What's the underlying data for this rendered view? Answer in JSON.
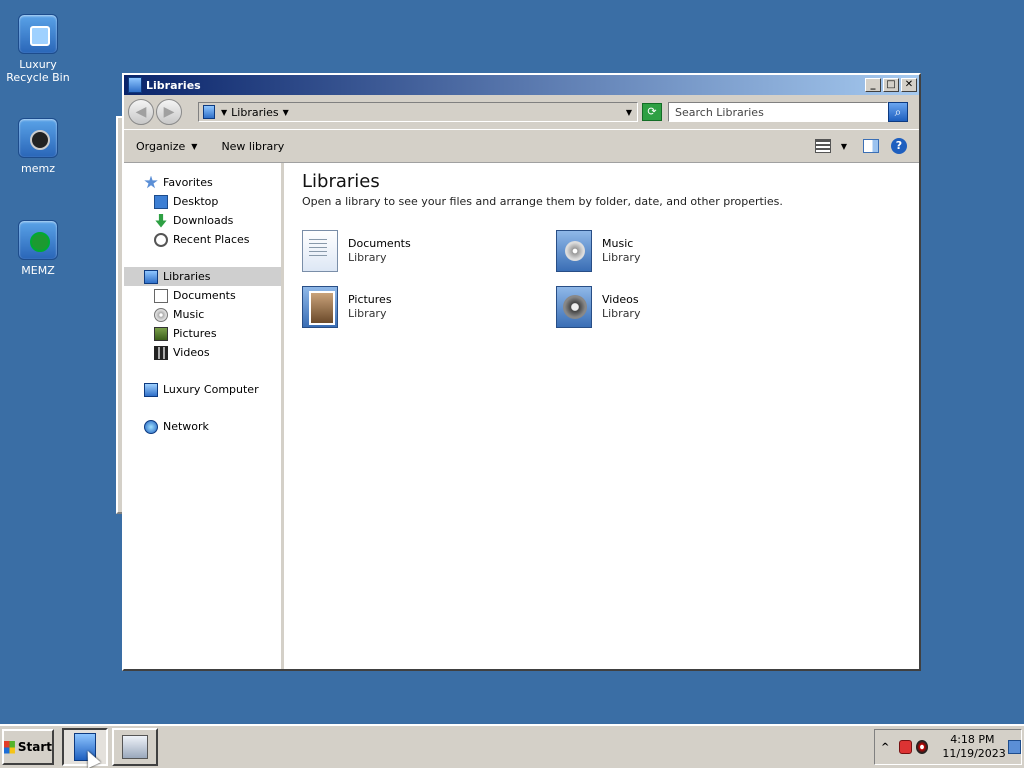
{
  "desktop": {
    "icons": [
      {
        "label": "Luxury Recycle Bin"
      },
      {
        "label": "memz"
      },
      {
        "label": "MEMZ"
      }
    ]
  },
  "window": {
    "title": "Libraries",
    "controls": {
      "minimize": "_",
      "maximize": "□",
      "close": "✕"
    }
  },
  "addressbar": {
    "crumb": "Libraries",
    "search_placeholder": "Search Libraries"
  },
  "toolbar": {
    "organize": "Organize",
    "new_library": "New library"
  },
  "navpane": {
    "favorites": {
      "label": "Favorites",
      "items": [
        "Desktop",
        "Downloads",
        "Recent Places"
      ]
    },
    "libraries": {
      "label": "Libraries",
      "items": [
        "Documents",
        "Music",
        "Pictures",
        "Videos"
      ]
    },
    "computer": "Luxury Computer",
    "network": "Network"
  },
  "content": {
    "title": "Libraries",
    "description": "Open a library to see your files and arrange them by folder, date, and other properties.",
    "libraries": [
      {
        "name": "Documents",
        "type": "Library"
      },
      {
        "name": "Music",
        "type": "Library"
      },
      {
        "name": "Pictures",
        "type": "Library"
      },
      {
        "name": "Videos",
        "type": "Library"
      }
    ]
  },
  "taskbar": {
    "start_label": "Start",
    "tray": {
      "chevron": "^",
      "time": "4:18 PM",
      "date": "11/19/2023"
    }
  },
  "colors": {
    "desktop": "#3a6ea5",
    "titlebar_start": "#0a246a",
    "titlebar_end": "#a6caf0",
    "chrome": "#d4d0c8"
  }
}
